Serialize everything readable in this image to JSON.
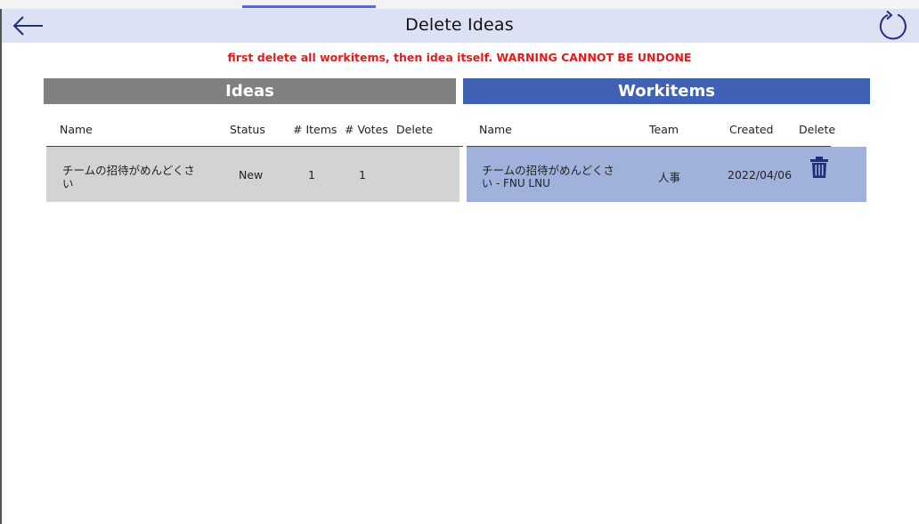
{
  "header": {
    "title": "Delete Ideas",
    "back_icon": "arrow-left-icon",
    "refresh_icon": "refresh-icon"
  },
  "warning": "first delete all workitems, then idea itself. WARNING CANNOT BE UNDONE",
  "ideas": {
    "title": "Ideas",
    "columns": [
      "Name",
      "Status",
      "# Items",
      "# Votes",
      "Delete"
    ],
    "rows": [
      {
        "name_line1": "チームの招待がめんどくさ",
        "name_line2": "い",
        "status": "New",
        "items": "1",
        "votes": "1"
      }
    ]
  },
  "workitems": {
    "title": "Workitems",
    "columns": [
      "Name",
      "Team",
      "Created",
      "Delete"
    ],
    "rows": [
      {
        "name_line1": "チームの招待がめんどくさ",
        "name_line2": "い - FNU LNU",
        "team": "人事",
        "created": "2022/04/06",
        "delete_icon": "trash-icon"
      }
    ]
  },
  "colors": {
    "header_bg": "#dce1f3",
    "ideas_header_bg": "#808080",
    "workitems_header_bg": "#3f62b5",
    "ideas_row_bg": "#d3d3d3",
    "workitems_row_bg": "#a0b1dc",
    "warning_text": "#e11b1b",
    "icon_color": "#1f2f7a"
  }
}
